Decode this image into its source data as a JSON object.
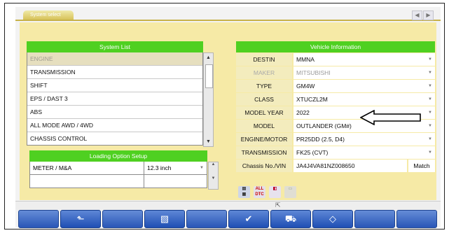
{
  "window": {
    "tab_label": "System select",
    "nav_prev": "◀",
    "nav_next": "▶"
  },
  "system_list": {
    "title": "System List",
    "items": [
      "ENGINE",
      "TRANSMISSION",
      "SHIFT",
      "EPS / DAST 3",
      "ABS",
      "ALL MODE AWD / 4WD",
      "CHASSIS CONTROL"
    ],
    "selected": "ENGINE"
  },
  "loading_option": {
    "title": "Loading Option Setup",
    "rows": [
      {
        "label": "METER / M&A",
        "value": "12.3 inch"
      }
    ]
  },
  "vehicle_info": {
    "title": "Vehicle Information",
    "fields": [
      {
        "label": "DESTIN",
        "value": "MMNA"
      },
      {
        "label": "MAKER",
        "value": "MITSUBISHI"
      },
      {
        "label": "TYPE",
        "value": "GM4W"
      },
      {
        "label": "CLASS",
        "value": "XTUCZL2M"
      },
      {
        "label": "MODEL YEAR",
        "value": "2022"
      },
      {
        "label": "MODEL",
        "value": "OUTLANDER (GM#)"
      },
      {
        "label": "ENGINE/MOTOR",
        "value": "PR25DD (2.5, D4)"
      },
      {
        "label": "TRANSMISSION",
        "value": "FK25 (CVT)"
      }
    ],
    "chassis": {
      "label": "Chassis No./VIN",
      "value": "JA4J4VA81NZ008650",
      "button": "Match"
    }
  },
  "icons": {
    "all_dtc": "ALL DTC"
  },
  "colors": {
    "header_green": "#4fd021",
    "panel_yellow": "#f6eaa6",
    "toolbar_blue": "#2a5cc0"
  }
}
